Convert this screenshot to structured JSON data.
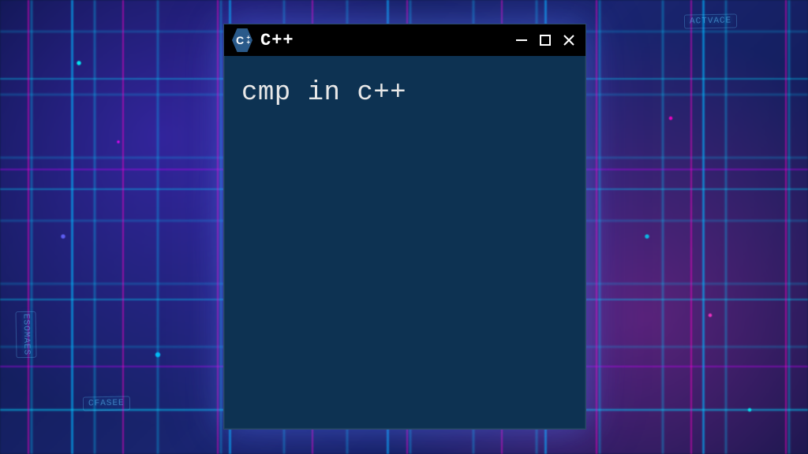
{
  "window": {
    "title": "C++",
    "icon_letter": "C",
    "icon_plus": "++"
  },
  "terminal": {
    "content": "cmp in c++"
  },
  "bg_labels": {
    "top_right": "ACTVACE",
    "left_mid": "ESOMAES",
    "bottom_left": "CFASEE"
  }
}
